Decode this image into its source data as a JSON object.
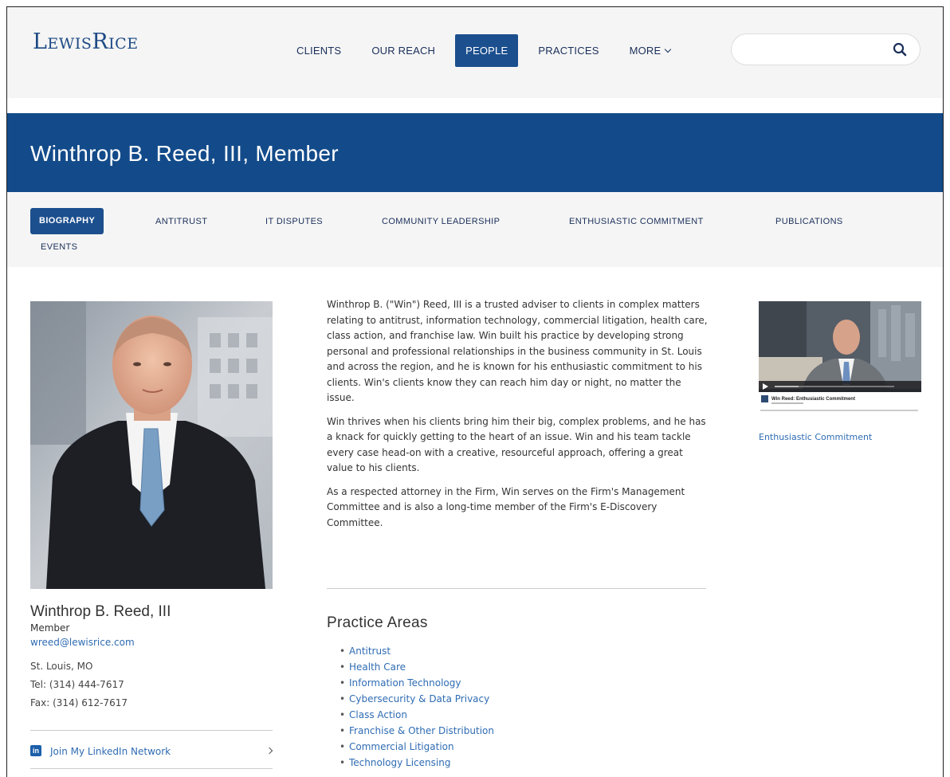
{
  "header": {
    "logo": "LewisRice",
    "nav": [
      "CLIENTS",
      "OUR REACH",
      "PEOPLE",
      "PRACTICES",
      "MORE"
    ],
    "active_nav": "PEOPLE",
    "search": {
      "placeholder": ""
    }
  },
  "banner": {
    "title": "Winthrop B. Reed, III,  Member"
  },
  "tabs": [
    "BIOGRAPHY",
    "ANTITRUST",
    "IT DISPUTES",
    "COMMUNITY LEADERSHIP",
    "ENTHUSIASTIC COMMITMENT",
    "PUBLICATIONS",
    "EVENTS"
  ],
  "active_tab": "BIOGRAPHY",
  "profile": {
    "name": "Winthrop B. Reed, III",
    "role": "Member",
    "email": "wreed@lewisrice.com",
    "city": "St. Louis, MO",
    "tel": "Tel: (314) 444-7617",
    "fax": "Fax: (314) 612-7617",
    "linkedin": "Join My LinkedIn Network"
  },
  "bio": [
    "Winthrop B. (\"Win\") Reed, III is a trusted adviser to clients in complex matters relating to antitrust, information technology, commercial litigation, health care, class action, and franchise law. Win built his practice by developing strong personal and professional relationships in the business community in St. Louis and across the region, and he is known for his enthusiastic commitment to his clients. Win's clients know they can reach him day or night, no matter the issue.",
    "Win thrives when his clients bring him their big, complex problems, and he has a knack for quickly getting to the heart of an issue. Win and his team tackle every case head-on with a creative, resourceful approach, offering a great value to his clients.",
    "As a respected attorney in the Firm, Win serves on the Firm's Management Committee and is also a long-time member of the Firm's E-Discovery Committee."
  ],
  "practice_areas": {
    "title": "Practice Areas",
    "items": [
      "Antitrust",
      "Health Care",
      "Information Technology",
      "Cybersecurity & Data Privacy",
      "Class Action",
      "Franchise & Other Distribution",
      "Commercial Litigation",
      "Technology Licensing"
    ]
  },
  "video": {
    "caption": "Enthusiastic Commitment",
    "overlay_title": "Win Reed: Enthusiastic Commitment"
  },
  "colors": {
    "brand": "#134b8a",
    "active": "#1c4f8e",
    "link": "#2f6cb3"
  }
}
